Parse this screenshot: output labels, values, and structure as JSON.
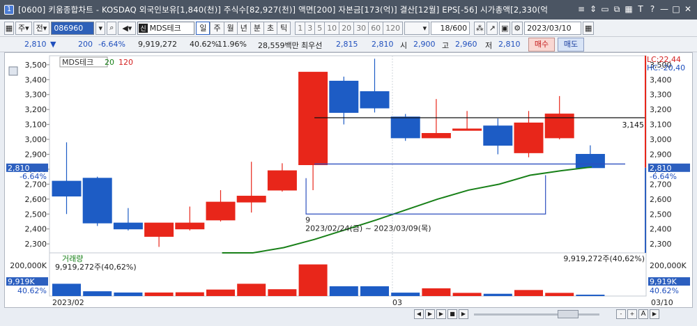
{
  "window": {
    "number": "1",
    "title": "[0600] 키움종합차트 - KOSDAQ 외국인보유[1,840(천)] 주식수[82,927(천)] 액면[200] 자본금[173(억)] 결산[12월] EPS[-56] 시가총액[2,330(억",
    "controls": [
      "≡",
      "⇕",
      "▭",
      "⧉",
      "▦",
      "T",
      "?",
      "—",
      "□",
      "✕"
    ]
  },
  "toolbar": {
    "market_code": "주",
    "market_type": "전",
    "stock_code": "086960",
    "stock_name_badge": "신",
    "stock_name": "MDS테크",
    "periods": [
      "일",
      "주",
      "월",
      "년",
      "분",
      "초",
      "틱"
    ],
    "active_period": "일",
    "intervals": [
      "1",
      "3",
      "5",
      "10",
      "20",
      "30",
      "60",
      "120"
    ],
    "count": "18/600",
    "date": "2023/03/10"
  },
  "quote": {
    "price": "2,810",
    "change_arrow": "▼",
    "change": "200",
    "change_pct": "-6.64%",
    "volume": "9,919,272",
    "volume_ratio": "40.62%",
    "turnover": "11.96%",
    "amount": "28,559백만",
    "best_ask_label": "최우선",
    "best_ask": "2,815",
    "best_bid": "2,810",
    "open_label": "시",
    "open": "2,900",
    "high_label": "고",
    "high": "2,960",
    "low_label": "저",
    "low": "2,810",
    "buy_label": "매수",
    "sell_label": "매도"
  },
  "chart_data": {
    "type": "candlestick",
    "legend": {
      "name": "MDS테크",
      "ma1": "20",
      "ma2": "120"
    },
    "lc": "LC:22,44",
    "hc": "HC:-20,40",
    "price_ticks": [
      "3,500",
      "3,400",
      "3,300",
      "3,200",
      "3,100",
      "3,000",
      "2,900",
      "2,800",
      "2,700",
      "2,600",
      "2,500",
      "2,400",
      "2,300"
    ],
    "price_ylim": [
      2240,
      3560
    ],
    "current_price_tag": "2,810",
    "current_pct_tag": "-6.64%",
    "hline_label": "3,145",
    "hline_value": 3145,
    "blue_hline_value": 2835,
    "box_label": "9",
    "range_label": "2023/02/24(금) ~ 2023/03/09(목)",
    "candles": [
      {
        "o": 2720,
        "h": 2980,
        "l": 2500,
        "c": 2620
      },
      {
        "o": 2740,
        "h": 2750,
        "l": 2420,
        "c": 2440
      },
      {
        "o": 2440,
        "h": 2540,
        "l": 2390,
        "c": 2400
      },
      {
        "o": 2350,
        "h": 2440,
        "l": 2280,
        "c": 2440
      },
      {
        "o": 2400,
        "h": 2550,
        "l": 2390,
        "c": 2440
      },
      {
        "o": 2460,
        "h": 2660,
        "l": 2450,
        "c": 2580
      },
      {
        "o": 2580,
        "h": 2850,
        "l": 2510,
        "c": 2620
      },
      {
        "o": 2660,
        "h": 2840,
        "l": 2650,
        "c": 2790
      },
      {
        "o": 2830,
        "h": 3450,
        "l": 2660,
        "c": 3450
      },
      {
        "o": 3390,
        "h": 3420,
        "l": 3100,
        "c": 3180
      },
      {
        "o": 3320,
        "h": 3540,
        "l": 3180,
        "c": 3210
      },
      {
        "o": 3150,
        "h": 3170,
        "l": 2990,
        "c": 3010
      },
      {
        "o": 3010,
        "h": 3270,
        "l": 3010,
        "c": 3040
      },
      {
        "o": 3060,
        "h": 3190,
        "l": 3060,
        "c": 3070
      },
      {
        "o": 3090,
        "h": 3140,
        "l": 2900,
        "c": 2960
      },
      {
        "o": 2910,
        "h": 3190,
        "l": 2880,
        "c": 3110
      },
      {
        "o": 3010,
        "h": 3290,
        "l": 3000,
        "c": 3170
      },
      {
        "o": 2900,
        "h": 2960,
        "l": 2810,
        "c": 2810
      }
    ],
    "ma20": [
      null,
      null,
      null,
      null,
      null,
      null,
      2215,
      2240,
      2275,
      2330,
      2395,
      2460,
      2530,
      2600,
      2660,
      2700,
      2760,
      2790,
      2815
    ],
    "volume_label": "거래량",
    "volume_text": "9,919,272주(40,62%)",
    "volume_text_right": "9,919,272주(40,62%)",
    "volume_tick": "200,000K",
    "volume_tag": "9,919K",
    "volume_pct_tag": "40.62%",
    "volumes": [
      10800,
      4200,
      3100,
      3100,
      3300,
      5700,
      10800,
      6000,
      27800,
      8600,
      8600,
      3000,
      6800,
      2800,
      2000,
      5300,
      2800,
      1200
    ],
    "volume_max": 30000,
    "date_labels": [
      "2023/02",
      "03"
    ],
    "end_date": "03/10"
  },
  "nav": {
    "buttons": [
      "◀",
      "▶",
      "▶",
      "■",
      "▶",
      "-",
      "+",
      "A",
      "▶"
    ]
  },
  "colors": {
    "up": "#e8261a",
    "down": "#1d5cc5",
    "ma20": "#188018",
    "titlebar": "#4b5563"
  }
}
